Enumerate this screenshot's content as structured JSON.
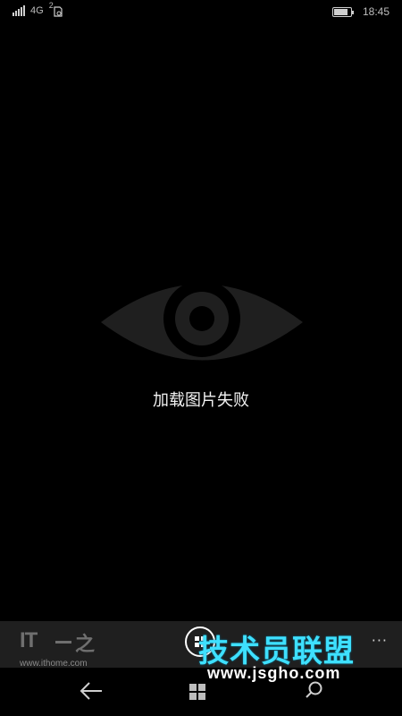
{
  "status_bar": {
    "network": "4G",
    "sim": "2",
    "time": "18:45",
    "battery_level": 0.85
  },
  "main": {
    "placeholder_icon": "eye-icon",
    "error_message": "加载图片失败"
  },
  "app_bar": {
    "logo_text": "IT",
    "logo_glyph": "之",
    "site_url": "www.ithome.com",
    "center_button_icon": "grid-icon",
    "more_label": "···"
  },
  "nav_bar": {
    "back_icon": "back-arrow-icon",
    "start_icon": "windows-icon",
    "search_icon": "search-icon"
  },
  "watermark": {
    "title": "技术员联盟",
    "url": "www.jsgho.com"
  },
  "colors": {
    "background": "#000000",
    "eye": "#1f1f1f",
    "app_bar": "#1f1f1f",
    "watermark_accent": "#3ee0ff"
  }
}
